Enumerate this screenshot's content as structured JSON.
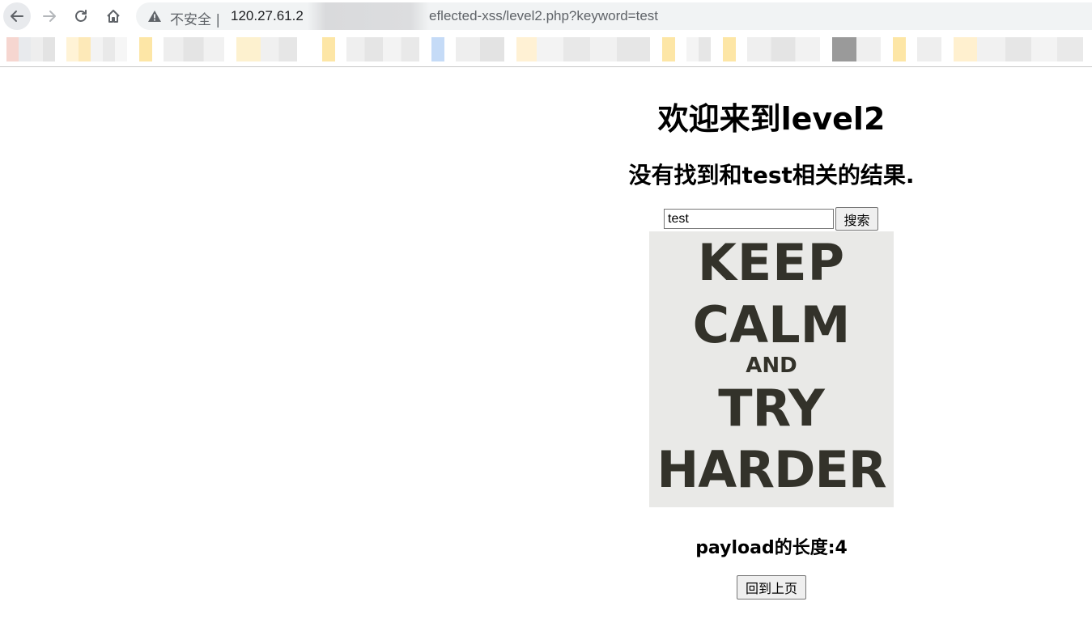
{
  "browser": {
    "security_label": "不安全",
    "url_host": "120.27.61.2",
    "url_path": "eflected-xss/level2.php?keyword=test",
    "icons": {
      "back": "arrow-left-icon",
      "forward": "arrow-right-icon",
      "reload": "reload-icon",
      "home": "home-icon",
      "security": "warning-triangle-icon"
    }
  },
  "page": {
    "welcome_title": "欢迎来到level2",
    "result_message": "没有找到和test相关的结果.",
    "search": {
      "value": "test",
      "button_label": "搜索"
    },
    "poster": {
      "lines": [
        "KEEP",
        "CALM",
        "AND",
        "TRY",
        "HARDER"
      ]
    },
    "payload_length_text": "payload的长度:4",
    "back_button_label": "回到上页"
  }
}
